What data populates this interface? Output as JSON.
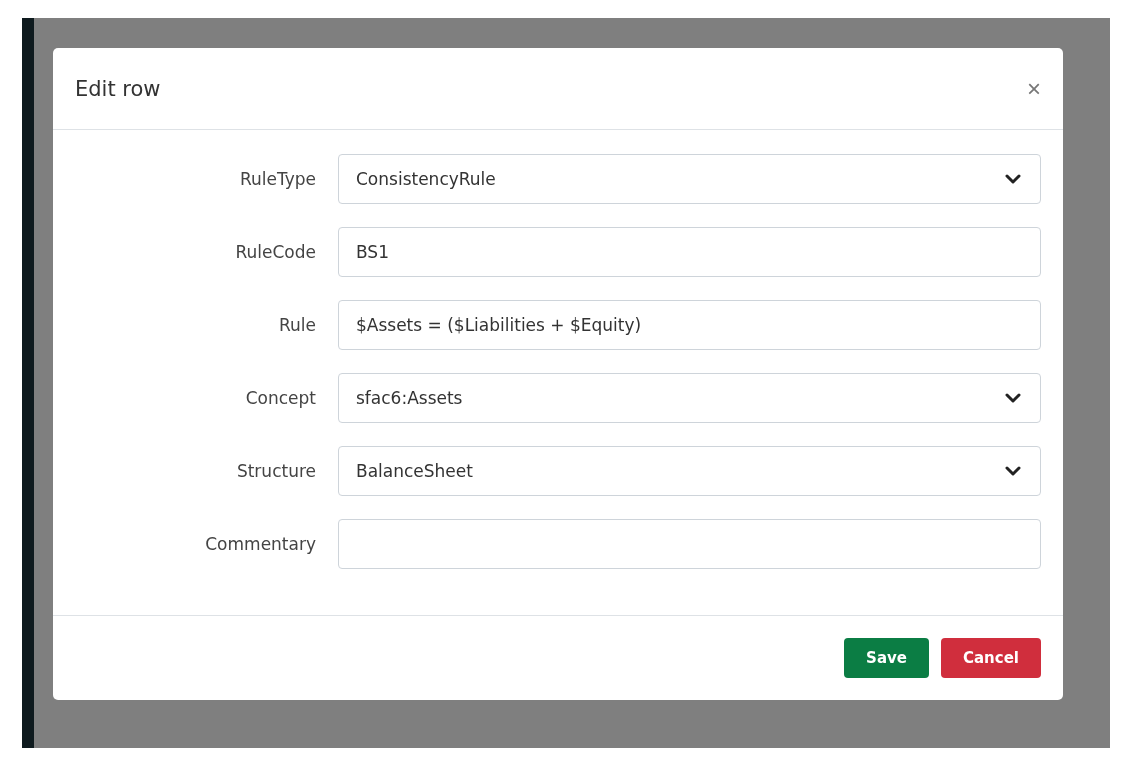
{
  "dialog": {
    "title": "Edit row",
    "close": "×"
  },
  "fields": [
    {
      "label": "RuleType",
      "kind": "select",
      "value": "ConsistencyRule"
    },
    {
      "label": "RuleCode",
      "kind": "text",
      "value": "BS1"
    },
    {
      "label": "Rule",
      "kind": "text",
      "value": "$Assets = ($Liabilities + $Equity)"
    },
    {
      "label": "Concept",
      "kind": "select",
      "value": "sfac6:Assets"
    },
    {
      "label": "Structure",
      "kind": "select",
      "value": "BalanceSheet"
    },
    {
      "label": "Commentary",
      "kind": "text"
    }
  ],
  "buttons": [
    {
      "label": "Save",
      "kind": "primary"
    },
    {
      "label": "Cancel",
      "kind": "danger"
    }
  ]
}
